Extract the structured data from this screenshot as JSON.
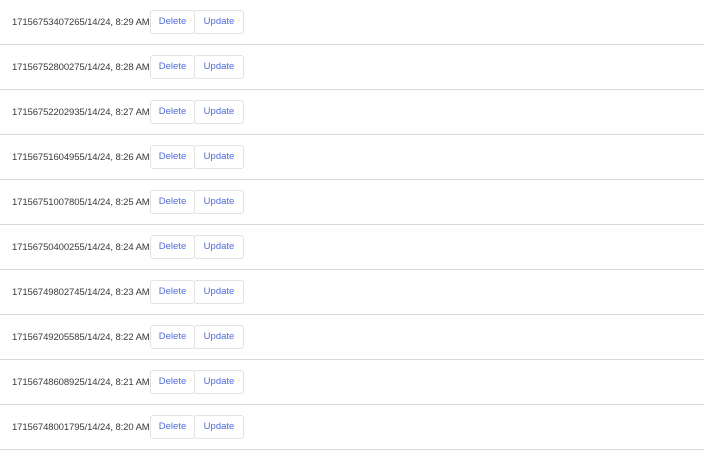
{
  "items": [
    {
      "text": "17156753407265/14/24, 8:29 AM",
      "delete_label": "Delete",
      "update_label": "Update"
    },
    {
      "text": "17156752800275/14/24, 8:28 AM",
      "delete_label": "Delete",
      "update_label": "Update"
    },
    {
      "text": "17156752202935/14/24, 8:27 AM",
      "delete_label": "Delete",
      "update_label": "Update"
    },
    {
      "text": "17156751604955/14/24, 8:26 AM",
      "delete_label": "Delete",
      "update_label": "Update"
    },
    {
      "text": "17156751007805/14/24, 8:25 AM",
      "delete_label": "Delete",
      "update_label": "Update"
    },
    {
      "text": "17156750400255/14/24, 8:24 AM",
      "delete_label": "Delete",
      "update_label": "Update"
    },
    {
      "text": "17156749802745/14/24, 8:23 AM",
      "delete_label": "Delete",
      "update_label": "Update"
    },
    {
      "text": "17156749205585/14/24, 8:22 AM",
      "delete_label": "Delete",
      "update_label": "Update"
    },
    {
      "text": "17156748608925/14/24, 8:21 AM",
      "delete_label": "Delete",
      "update_label": "Update"
    },
    {
      "text": "17156748001795/14/24, 8:20 AM",
      "delete_label": "Delete",
      "update_label": "Update"
    }
  ],
  "colors": {
    "button_text": "#4e6bd9",
    "divider": "#d9d9d9",
    "text": "#3a3a3a"
  }
}
